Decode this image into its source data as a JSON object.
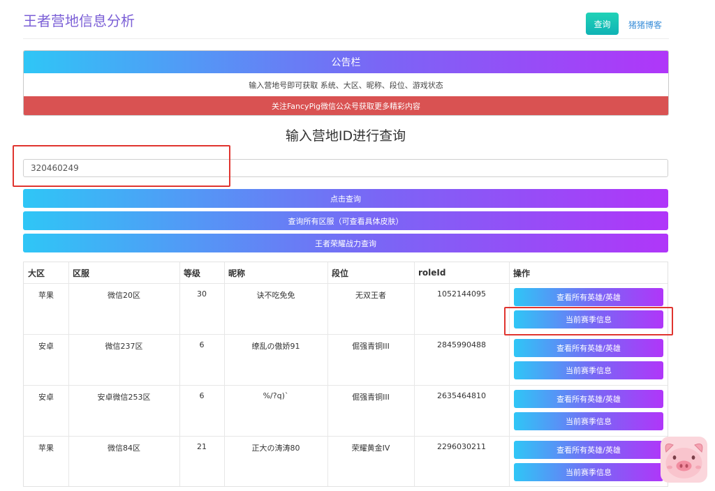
{
  "header": {
    "title": "王者营地信息分析",
    "query_label": "查询",
    "blog_label": "猪猪博客"
  },
  "notice": {
    "title": "公告栏",
    "body": "输入营地号即可获取 系统、大区、昵称、段位、游戏状态",
    "footer": "关注FancyPig微信公众号获取更多精彩内容"
  },
  "search": {
    "section_title": "输入营地ID进行查询",
    "input_value": "320460249",
    "btn_query": "点击查询",
    "btn_all_servers": "查询所有区服（可查看具体皮肤）",
    "btn_power": "王者荣耀战力查询"
  },
  "table": {
    "columns": [
      "大区",
      "区服",
      "等级",
      "昵称",
      "段位",
      "roleId",
      "操作"
    ],
    "action_all_heroes": "查看所有英雄/英雄",
    "action_season": "当前赛季信息",
    "rows": [
      {
        "region": "苹果",
        "server": "微信20区",
        "level": "30",
        "nickname": "诀不吃免免",
        "rank": "无双王者",
        "roleid": "1052144095"
      },
      {
        "region": "安卓",
        "server": "微信237区",
        "level": "6",
        "nickname": "缭乱の傲娇91",
        "rank": "倔强青铜III",
        "roleid": "2845990488"
      },
      {
        "region": "安卓",
        "server": "安卓微信253区",
        "level": "6",
        "nickname": "%/?q)`",
        "rank": "倔强青铜III",
        "roleid": "2635464810"
      },
      {
        "region": "苹果",
        "server": "微信84区",
        "level": "21",
        "nickname": "正大の涛涛80",
        "rank": "荣耀黄金IV",
        "roleid": "2296030211"
      }
    ]
  },
  "colors": {
    "accent_start": "#2fc6f6",
    "accent_end": "#b036f9",
    "alert": "#d95252",
    "title": "#7b5fd6",
    "highlight": "#e0342f"
  }
}
